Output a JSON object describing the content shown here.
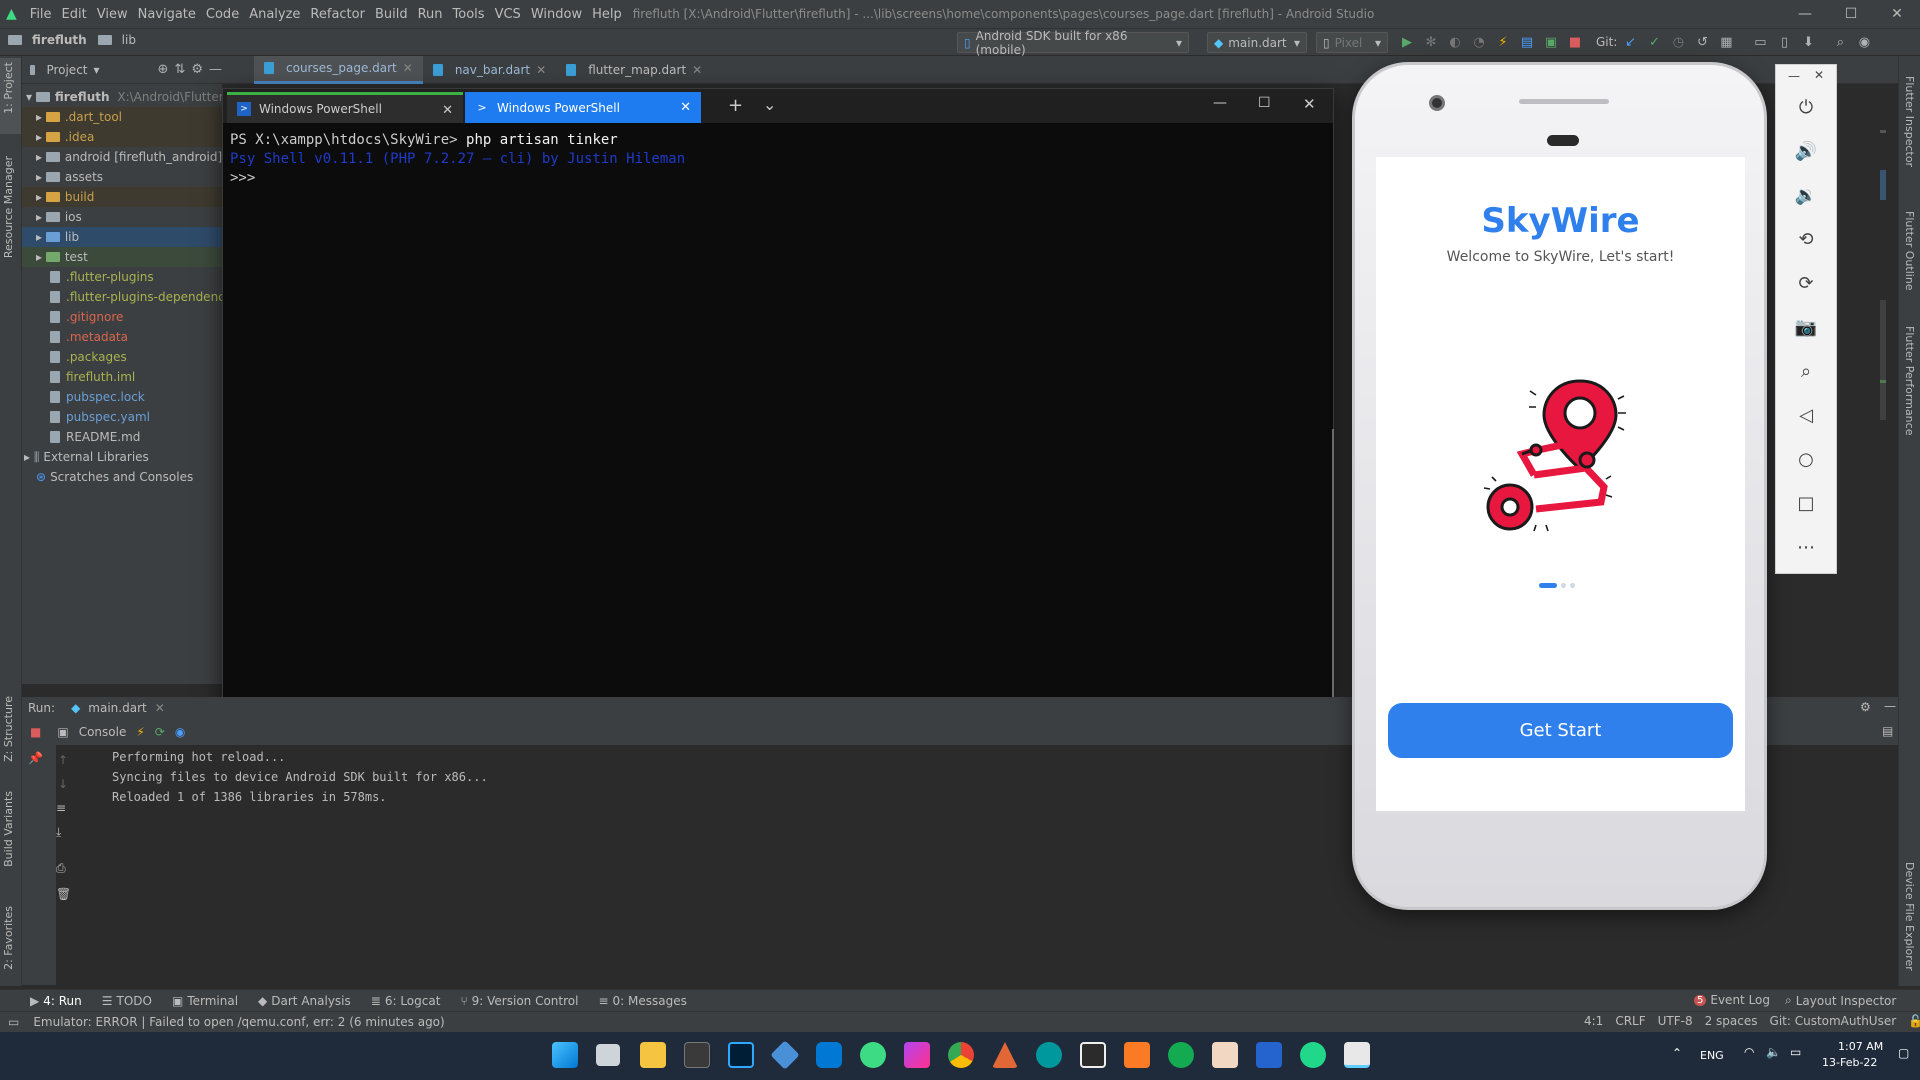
{
  "menubar": {
    "items": [
      "File",
      "Edit",
      "View",
      "Navigate",
      "Code",
      "Analyze",
      "Refactor",
      "Build",
      "Run",
      "Tools",
      "VCS",
      "Window",
      "Help"
    ],
    "title": "firefluth [X:\\Android\\Flutter\\firefluth] - ...\\lib\\screens\\home\\components\\pages\\courses_page.dart [firefluth] - Android Studio",
    "min": "—",
    "max": "☐",
    "close": "✕"
  },
  "navbar": {
    "project": "firefluth",
    "folder": "lib",
    "device": "Android SDK built for x86 (mobile)",
    "run_config": "main.dart",
    "pixel": "Pixel",
    "git": "Git:"
  },
  "left_strip": {
    "project": "1: Project",
    "resource": "Resource Manager",
    "structure": "Z: Structure",
    "build_variants": "Build Variants",
    "favorites": "2: Favorites"
  },
  "right_strip": {
    "inspector": "Flutter Inspector",
    "outline": "Flutter Outline",
    "performance": "Flutter Performance",
    "device_explorer": "Device File Explorer"
  },
  "project_panel": {
    "title": "Project",
    "root": "firefluth",
    "root_path": "X:\\Android\\Flutter\\fi",
    "items": [
      {
        "label": ".dart_tool",
        "color": "#c7a04b"
      },
      {
        "label": ".idea",
        "color": "#c7a04b"
      },
      {
        "label": "android [firefluth_android]",
        "color": "#bbbbbb"
      },
      {
        "label": "assets",
        "color": "#bbbbbb"
      },
      {
        "label": "build",
        "color": "#c7a04b"
      },
      {
        "label": "ios",
        "color": "#bbbbbb"
      },
      {
        "label": "lib",
        "color": "#bbbbbb"
      },
      {
        "label": "test",
        "color": "#bbbbbb"
      },
      {
        "label": ".flutter-plugins",
        "color": "#a8b34f"
      },
      {
        "label": ".flutter-plugins-dependencies",
        "color": "#a8b34f"
      },
      {
        "label": ".gitignore",
        "color": "#d9664d"
      },
      {
        "label": ".metadata",
        "color": "#d9664d"
      },
      {
        "label": ".packages",
        "color": "#a8b34f"
      },
      {
        "label": "firefluth.iml",
        "color": "#a8b34f"
      },
      {
        "label": "pubspec.lock",
        "color": "#6a9fd6"
      },
      {
        "label": "pubspec.yaml",
        "color": "#6a9fd6"
      },
      {
        "label": "README.md",
        "color": "#bbbbbb"
      }
    ],
    "external": "External Libraries",
    "scratches": "Scratches and Consoles"
  },
  "editor_tabs": [
    "courses_page.dart",
    "nav_bar.dart",
    "flutter_map.dart"
  ],
  "powershell": {
    "tab1": "Windows PowerShell",
    "tab2": "Windows PowerShell",
    "new_tab": "+",
    "dropdown": "⌄",
    "line1_prompt": "PS X:\\xampp\\htdocs\\SkyWire>",
    "line1_cmd": "php artisan tinker",
    "line2": "Psy Shell v0.11.1 (PHP 7.2.27 — cli) by Justin Hileman",
    "line3": ">>>"
  },
  "run_panel": {
    "label": "Run:",
    "tab": "main.dart",
    "console_tab": "Console",
    "lines": [
      "Performing hot reload...",
      "Syncing files to device Android SDK built for x86...",
      "Reloaded 1 of 1386 libraries in 578ms."
    ]
  },
  "bottom_tools": {
    "run": "4: Run",
    "todo": "TODO",
    "terminal": "Terminal",
    "dart": "Dart Analysis",
    "logcat": "6: Logcat",
    "vcs": "9: Version Control",
    "messages": "0: Messages",
    "event_log": "Event Log",
    "event_count": "5",
    "layout": "Layout Inspector"
  },
  "statusbar": {
    "message": "Emulator: ERROR  | Failed to open /qemu.conf, err: 2 (6 minutes ago)",
    "pos": "4:1",
    "crlf": "CRLF",
    "enc": "UTF-8",
    "indent": "2 spaces",
    "git": "Git: CustomAuthUser"
  },
  "phone_app": {
    "title": "SkyWire",
    "subtitle": "Welcome to SkyWire, Let's start!",
    "button": "Get Start",
    "accent": "#2f80ed",
    "illustration_color": "#e8173f"
  },
  "taskbar": {
    "lang": "ENG",
    "time": "1:07 AM",
    "date": "13-Feb-22"
  }
}
